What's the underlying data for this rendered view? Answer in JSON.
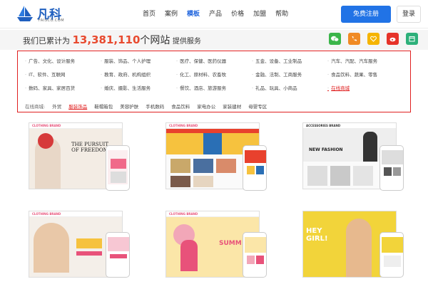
{
  "header": {
    "logo_text": "凡科",
    "logo_sub": "FAISCO.COM",
    "nav": [
      "首页",
      "案例",
      "模板",
      "产品",
      "价格",
      "加盟",
      "帮助"
    ],
    "nav_active_index": 2,
    "register_label": "免费注册",
    "login_label": "登录"
  },
  "stats": {
    "prefix": "我们已累计为",
    "count": "13,381,110",
    "suffix": "个网站",
    "tail": "提供服务"
  },
  "social": [
    {
      "icon": "wechat-icon",
      "color": "#3bb54a"
    },
    {
      "icon": "phone-icon",
      "color": "#f08a24"
    },
    {
      "icon": "heart-icon",
      "color": "#f5b400"
    },
    {
      "icon": "weibo-icon",
      "color": "#e6332a"
    },
    {
      "icon": "calendar-icon",
      "color": "#2db07a"
    }
  ],
  "categories": [
    [
      "广告、文化、设计服务",
      "服装、饰品、个人护理",
      "医疗、保健、医药仪器",
      "五金、设备、工业制品",
      "汽车、汽配、汽车服务"
    ],
    [
      "IT、软件、互联网",
      "教育、政府、机构组织",
      "化工、原材料、农畜牧",
      "金融、法制、工商服务",
      "食品饮料、蔬果、零售"
    ],
    [
      "数码、家具、家居百货",
      "婚庆、摄影、生活服务",
      "餐饮、酒店、旅游服务",
      "礼品、玩具、小商品",
      "在线商城"
    ]
  ],
  "tags": {
    "label": "在线商城:",
    "items": [
      "外贸",
      "服装饰品",
      "鞋帽箱包",
      "美容护肤",
      "手机数码",
      "食品饮料",
      "家电办公",
      "家装建材",
      "母婴专区"
    ],
    "active_index": 1
  },
  "templates": [
    {
      "brand": "CLOTHING BRAND",
      "headline": "THE PURSUIT OF FREEDOM",
      "accent": "#e8527a"
    },
    {
      "brand": "CLOTHING BRAND",
      "headline": "",
      "accent": "#e8527a"
    },
    {
      "brand": "ACCESSORIES BRAND",
      "headline": "NEW FASHION",
      "accent": "#333333"
    },
    {
      "brand": "CLOTHING BRAND",
      "headline": "",
      "accent": "#e8527a"
    },
    {
      "brand": "CLOTHING BRAND",
      "headline": "SUMM",
      "accent": "#e8527a"
    },
    {
      "brand": "",
      "headline": "HEY GIRL!",
      "accent": "#f2d43a"
    }
  ]
}
